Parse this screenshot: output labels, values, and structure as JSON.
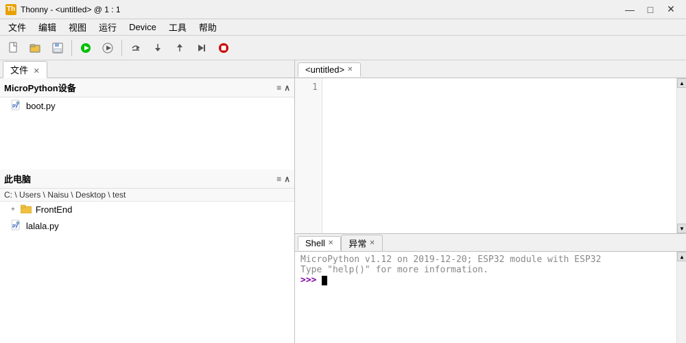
{
  "titleBar": {
    "icon": "Th",
    "title": "Thonny  -  <untitled>  @  1 : 1",
    "minimize": "—",
    "maximize": "□",
    "close": "✕"
  },
  "menuBar": {
    "items": [
      "文件",
      "编辑",
      "视图",
      "运行",
      "Device",
      "工具",
      "帮助"
    ]
  },
  "toolbar": {
    "buttons": [
      "new",
      "open",
      "save",
      "run",
      "debug",
      "stepOver",
      "stepInto",
      "stepOut",
      "resume",
      "stop"
    ]
  },
  "leftPanel": {
    "tab": "文件",
    "micropythonSection": {
      "header": "MicroPython设备",
      "files": [
        {
          "name": "boot.py",
          "type": "py"
        }
      ]
    },
    "localSection": {
      "header": "此电脑",
      "path": "C: \\ Users \\ Naisu \\ Desktop \\ test",
      "items": [
        {
          "name": "FrontEnd",
          "type": "folder",
          "expanded": false
        },
        {
          "name": "lalala.py",
          "type": "py"
        }
      ]
    }
  },
  "editorPanel": {
    "tabs": [
      {
        "label": "<untitled>",
        "active": true,
        "closable": true
      }
    ],
    "lineNumbers": [
      "1"
    ],
    "content": ""
  },
  "shellPanel": {
    "tabs": [
      {
        "label": "Shell",
        "active": true,
        "closable": true
      },
      {
        "label": "异常",
        "active": false,
        "closable": true
      }
    ],
    "infoLine1": "MicroPython v1.12 on 2019-12-20; ESP32 module with ESP32",
    "infoLine2": "Type \"help()\" for more information.",
    "prompt": ">>> "
  }
}
